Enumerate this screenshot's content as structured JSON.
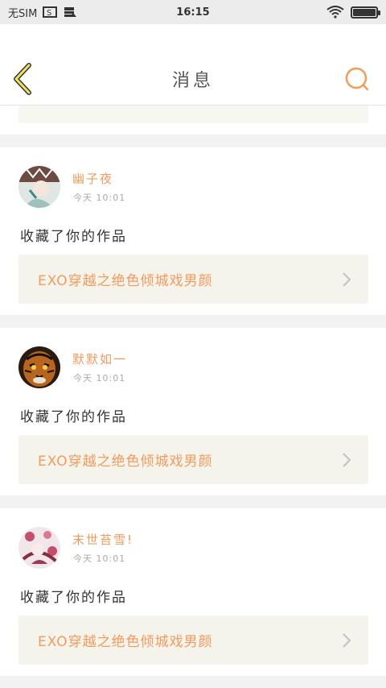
{
  "status_bar": {
    "sim_text": "无SIM",
    "time": "16:15",
    "battery_level": 1.0
  },
  "header": {
    "title": "消息",
    "back_icon": "chevron-left-icon",
    "search_icon": "search-icon",
    "accent_color": "#f39a5c"
  },
  "messages": [
    {
      "user": "幽子夜",
      "time": "今天 10:01",
      "action": "收藏了你的作品",
      "work_title": "EXO穿越之绝色倾城戏男颜"
    },
    {
      "user": "默默如一",
      "time": "今天 10:01",
      "action": "收藏了你的作品",
      "work_title": "EXO穿越之绝色倾城戏男颜"
    },
    {
      "user": "末世苔雪!",
      "time": "今天 10:01",
      "action": "收藏了你的作品",
      "work_title": "EXO穿越之绝色倾城戏男颜"
    }
  ]
}
